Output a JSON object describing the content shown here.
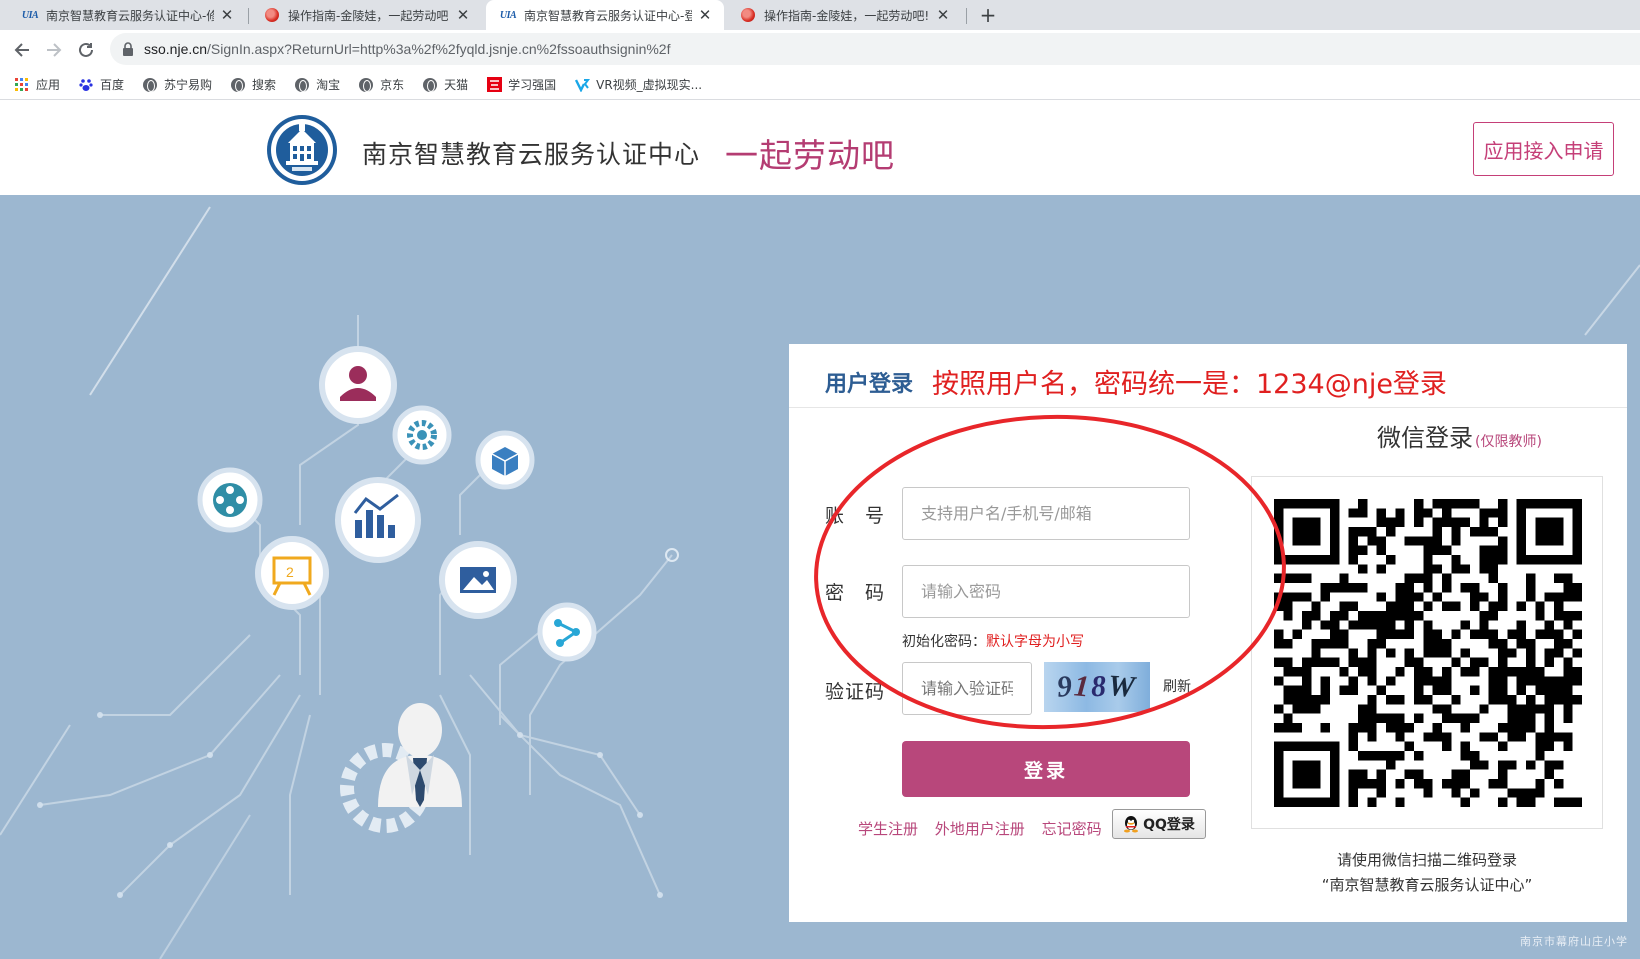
{
  "browser": {
    "tabs": [
      {
        "title": "南京智慧教育云服务认证中心-修",
        "close": "✕"
      },
      {
        "title": "操作指南-金陵娃，一起劳动吧!",
        "close": "✕"
      },
      {
        "title": "南京智慧教育云服务认证中心-登",
        "close": "✕"
      },
      {
        "title": "操作指南-金陵娃，一起劳动吧!",
        "close": "✕"
      }
    ],
    "new_tab": "+",
    "url_host": "sso.nje.cn",
    "url_path": "/SignIn.aspx?ReturnUrl=http%3a%2f%2fyqld.jsnje.cn%2fssoauthsignin%2f",
    "bookmarks": [
      "应用",
      "百度",
      "苏宁易购",
      "搜索",
      "淘宝",
      "京东",
      "天猫",
      "学习强国",
      "VR视频_虚拟现实..."
    ]
  },
  "header": {
    "site_title": "南京智慧教育云服务认证中心",
    "slogan": "一起劳动吧",
    "apply_button": "应用接入申请"
  },
  "login": {
    "tab_label": "用户登录",
    "notice": "按照用户名，密码统一是：1234@nje登录",
    "account_label": "账　号",
    "account_placeholder": "支持用户名/手机号/邮箱",
    "password_label": "密　码",
    "password_placeholder": "请输入密码",
    "hint_prefix": "初始化密码：",
    "hint_red": "默认字母为小写",
    "captcha_label": "验证码",
    "captcha_placeholder": "请输入验证码",
    "captcha_chars": [
      "9",
      "1",
      "8",
      "W"
    ],
    "refresh": "刷新",
    "submit": "登录",
    "links": [
      "学生注册",
      "外地用户注册",
      "忘记密码"
    ],
    "qq_button": "QQ登录"
  },
  "wechat": {
    "title": "微信登录",
    "subtitle": "(仅限教师)",
    "caption_line1": "请使用微信扫描二维码登录",
    "caption_line2": "“南京智慧教育云服务认证中心”"
  },
  "watermark": "南京市幕府山庄小学",
  "colors": {
    "brand": "#b8477b",
    "hero_bg": "#9cb7d0",
    "notice_red": "#e02020",
    "tab_blue": "#2d5d93"
  }
}
